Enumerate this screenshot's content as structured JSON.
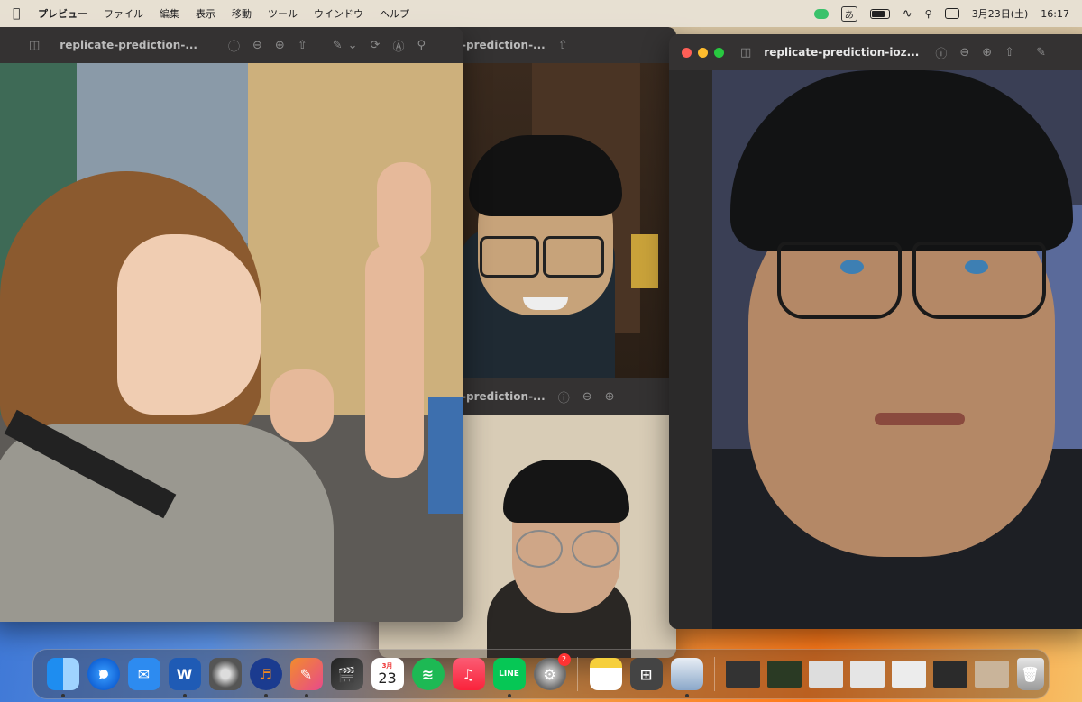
{
  "menubar": {
    "apple_icon": "apple-logo-icon",
    "app_name": "プレビュー",
    "menus": [
      "ファイル",
      "編集",
      "表示",
      "移動",
      "ツール",
      "ウインドウ",
      "ヘルプ"
    ],
    "input_mode": "あ",
    "date": "3月23日(土)",
    "time": "16:17"
  },
  "windows": {
    "left_title": "replicate-prediction-...",
    "middle_title": "-prediction-...",
    "middle_lower_title": "-prediction-...",
    "right_title": "replicate-prediction-ioz..."
  },
  "dock": {
    "calendar_month": "3月",
    "calendar_day": "23",
    "settings_badge": "2",
    "apps": [
      "finder-icon",
      "safari-icon",
      "mail-icon",
      "word-icon",
      "disk-utility-icon",
      "audacity-icon",
      "affinity-icon",
      "final-cut-icon",
      "calendar-icon",
      "spotify-icon",
      "music-icon",
      "line-icon",
      "system-settings-icon",
      "notes-icon",
      "calculator-icon",
      "preview-icon",
      "trash-icon"
    ]
  },
  "colors": {
    "titlebar": "#343232",
    "close": "#ff5f57",
    "minimize": "#febc2e",
    "zoom": "#28c840"
  }
}
